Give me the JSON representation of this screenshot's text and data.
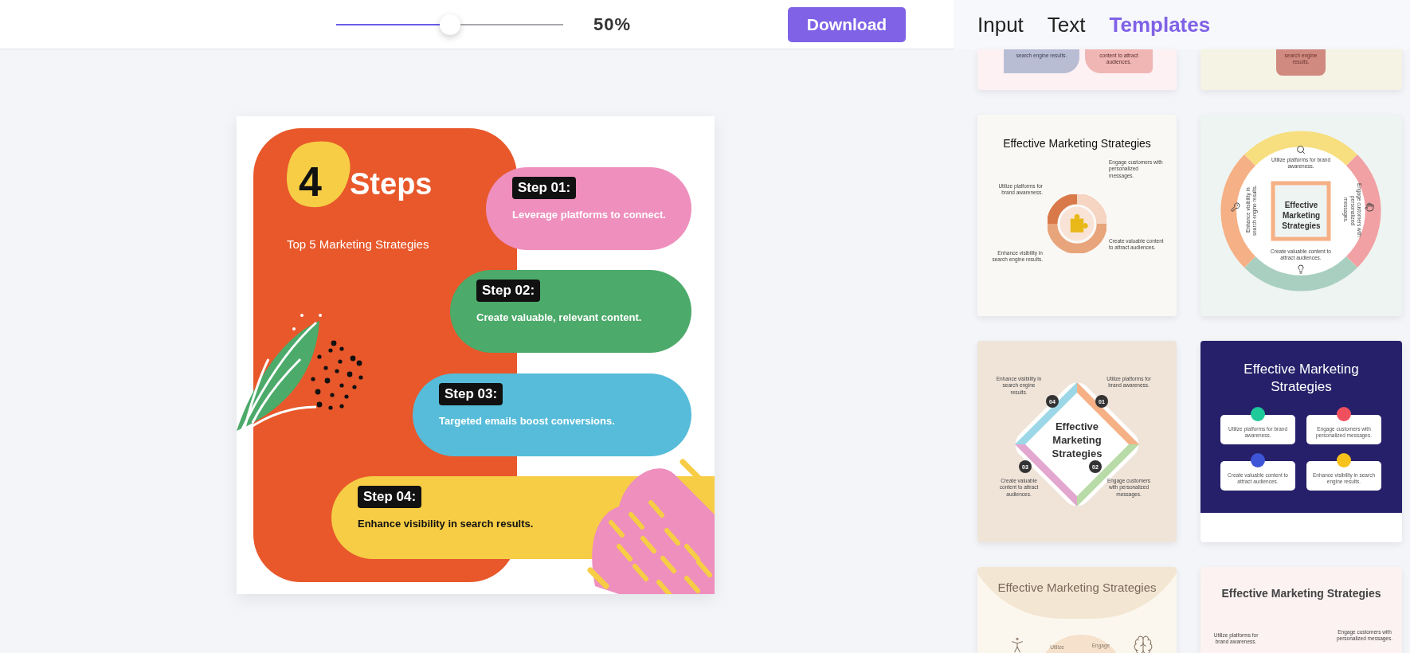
{
  "toolbar": {
    "zoom": {
      "level": 0.5,
      "reading": "50%"
    },
    "download": "Download"
  },
  "tabs": [
    {
      "label": "Input",
      "selected": false
    },
    {
      "label": "Text",
      "selected": false
    },
    {
      "label": "Templates",
      "selected": true
    }
  ],
  "canvas": {
    "number": "4",
    "title": "Steps",
    "subtitle": "Top 5 Marketing Strategies",
    "steps": [
      {
        "label": "Step 01:",
        "text": "Leverage platforms to connect.",
        "color": "#ee8fbd"
      },
      {
        "label": "Step 02:",
        "text": "Create valuable, relevant content.",
        "color": "#4caa6a"
      },
      {
        "label": "Step 03:",
        "text": "Targeted emails boost conversions.",
        "color": "#56bcd9"
      },
      {
        "label": "Step 04:",
        "text": "Enhance visibility in search results.",
        "color": "#f6cd45"
      }
    ]
  },
  "templates": [
    {
      "kind": "blocks",
      "items": [
        {
          "text": "search engine results."
        },
        {
          "text": "content to attract audiences."
        }
      ]
    },
    {
      "kind": "note",
      "items": [
        {
          "text": "search engine results."
        }
      ]
    },
    {
      "kind": "cycle",
      "title": "Effective Marketing Strategies",
      "items": [
        {
          "text": "Utilize platforms for brand awareness."
        },
        {
          "text": "Engage customers with personalized messages."
        },
        {
          "text": "Create valuable content to attract audiences."
        },
        {
          "text": "Enhance visibility in search engine results."
        }
      ]
    },
    {
      "kind": "ring",
      "title": "Effective Marketing Strategies",
      "items": [
        {
          "text": "Utilize platforms for brand awareness."
        },
        {
          "text": "Engage customers with personalized messages."
        },
        {
          "text": "Create valuable content to attract audiences."
        },
        {
          "text": "Enhance visibility in search engine results."
        }
      ]
    },
    {
      "kind": "diamond",
      "title": "Effective Marketing Strategies",
      "items": [
        {
          "number": "04",
          "text": "Enhance visibility in search engine results."
        },
        {
          "number": "01",
          "text": "Utilize platforms for brand awareness."
        },
        {
          "number": "03",
          "text": "Create valuable content to attract audiences."
        },
        {
          "number": "02",
          "text": "Engage customers with personalized messages."
        }
      ]
    },
    {
      "kind": "cards",
      "title": "Effective Marketing Strategies",
      "items": [
        {
          "text": "Utilize platforms for brand awareness.",
          "color": "#1ec99a"
        },
        {
          "text": "Engage customers with personalized messages.",
          "color": "#f0505e"
        },
        {
          "text": "Create valuable content to attract audiences.",
          "color": "#3f55d8"
        },
        {
          "text": "Enhance visibility in search engine results.",
          "color": "#f7c21a"
        }
      ]
    },
    {
      "kind": "arch",
      "title": "Effective Marketing Strategies",
      "items": [
        {
          "text": "Utilize"
        },
        {
          "text": "Engage"
        }
      ]
    },
    {
      "kind": "callouts",
      "title": "Effective Marketing Strategies",
      "items": [
        {
          "text": "Utilize platforms for brand awareness."
        },
        {
          "text": "Engage customers with personalized messages."
        }
      ]
    }
  ]
}
